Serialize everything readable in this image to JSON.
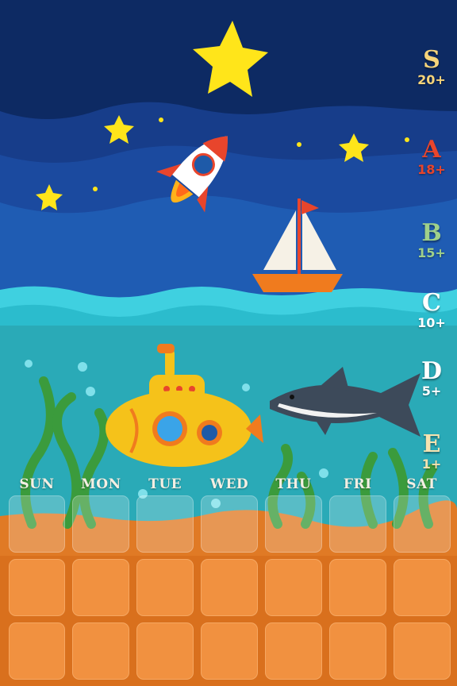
{
  "grades": [
    {
      "letter": "S",
      "requirement": "20+",
      "color": "#f6d47a"
    },
    {
      "letter": "A",
      "requirement": "18+",
      "color": "#e8452c"
    },
    {
      "letter": "B",
      "requirement": "15+",
      "color": "#9fd08a"
    },
    {
      "letter": "C",
      "requirement": "10+",
      "color": "#ffffff"
    },
    {
      "letter": "D",
      "requirement": "5+",
      "color": "#ffffff"
    },
    {
      "letter": "E",
      "requirement": "1+",
      "color": "#f6e3b0"
    }
  ],
  "weekdays": [
    "SUN",
    "MON",
    "TUE",
    "WED",
    "THU",
    "FRI",
    "SAT"
  ],
  "calendar_rows": 3,
  "colors": {
    "night_sky": "#0d2a63",
    "ocean": "#2fb3c0",
    "sand": "#e07a25",
    "star": "#ffe51a"
  }
}
